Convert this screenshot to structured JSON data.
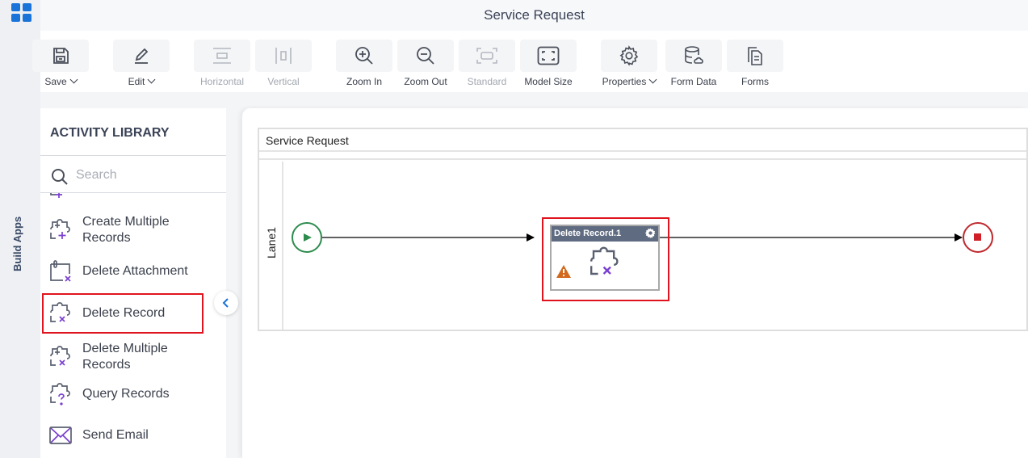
{
  "header": {
    "title": "Service Request"
  },
  "left_rail": {
    "label": "Build Apps"
  },
  "toolbar": {
    "items": [
      {
        "label": "Save",
        "icon": "save-icon",
        "dropdown": true,
        "disabled": false
      },
      {
        "label": "Edit",
        "icon": "edit-icon",
        "dropdown": true,
        "disabled": false
      },
      {
        "label": "Horizontal",
        "icon": "horizontal-icon",
        "dropdown": false,
        "disabled": true
      },
      {
        "label": "Vertical",
        "icon": "vertical-icon",
        "dropdown": false,
        "disabled": true
      },
      {
        "label": "Zoom In",
        "icon": "zoom-in-icon",
        "dropdown": false,
        "disabled": false
      },
      {
        "label": "Zoom Out",
        "icon": "zoom-out-icon",
        "dropdown": false,
        "disabled": false
      },
      {
        "label": "Standard",
        "icon": "standard-icon",
        "dropdown": false,
        "disabled": true
      },
      {
        "label": "Model Size",
        "icon": "model-size-icon",
        "dropdown": false,
        "disabled": false
      },
      {
        "label": "Properties",
        "icon": "gear-icon",
        "dropdown": true,
        "disabled": false
      },
      {
        "label": "Form Data",
        "icon": "database-icon",
        "dropdown": false,
        "disabled": false
      },
      {
        "label": "Forms",
        "icon": "forms-icon",
        "dropdown": false,
        "disabled": false
      }
    ]
  },
  "library": {
    "title": "ACTIVITY LIBRARY",
    "search_placeholder": "Search",
    "items": [
      {
        "label": "Create Multiple Records",
        "icon": "puzzle-plus-icon"
      },
      {
        "label": "Delete Attachment",
        "icon": "attachment-delete-icon"
      },
      {
        "label": "Delete Record",
        "icon": "puzzle-x-icon",
        "selected": true
      },
      {
        "label": "Delete Multiple Records",
        "icon": "puzzle-plus-x-icon"
      },
      {
        "label": "Query Records",
        "icon": "puzzle-question-icon"
      },
      {
        "label": "Send Email",
        "icon": "email-icon"
      }
    ]
  },
  "canvas": {
    "pool_name": "Service Request",
    "lane_name": "Lane1",
    "task": {
      "label": "Delete Record.1",
      "warning": true
    },
    "colors": {
      "start": "#2e8b4e",
      "end": "#c0282d",
      "selection": "#e0141e",
      "warning": "#d2691e",
      "task_header": "#5f6b80"
    }
  }
}
